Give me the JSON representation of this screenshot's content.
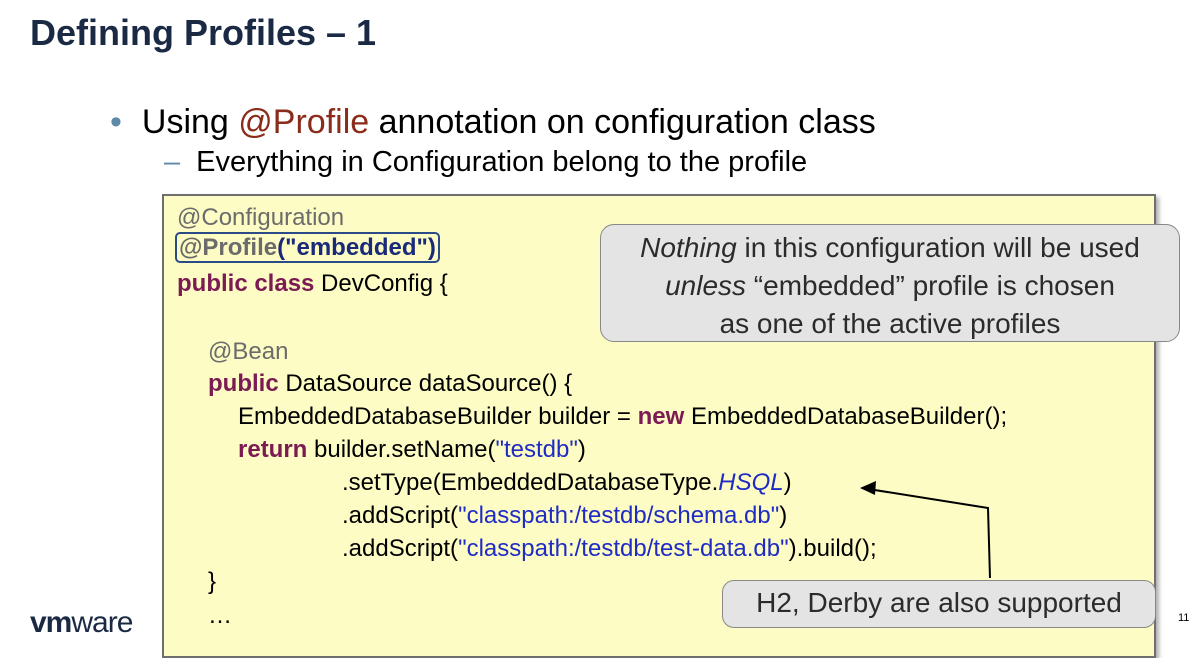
{
  "slide": {
    "title": "Defining Profiles – 1",
    "bullet": {
      "prefix": "Using ",
      "annotation": "@Profile",
      "suffix": " annotation on configuration class"
    },
    "subbullet": "Everything in Configuration belong to the profile",
    "page_number": "11",
    "logo": {
      "vm": "vm",
      "ware": "ware"
    }
  },
  "code": {
    "l1": "@Configuration",
    "l2_ann": "@Profile",
    "l2_str": "(\"embedded\")",
    "l3_kw": "public class",
    "l3_rest": " DevConfig {",
    "l4": "@Bean",
    "l5_kw": "public",
    "l5_rest": " DataSource dataSource() {",
    "l6_a": "EmbeddedDatabaseBuilder builder = ",
    "l6_kw": "new",
    "l6_b": " EmbeddedDatabaseBuilder();",
    "l7_kw": "return",
    "l7_a": " builder.setName(",
    "l7_str": "\"testdb\"",
    "l7_b": ")",
    "l8_a": ".setType(EmbeddedDatabaseType.",
    "l8_it": "HSQL",
    "l8_b": ")",
    "l9_a": ".addScript(",
    "l9_str": "\"classpath:/testdb/schema.db\"",
    "l9_b": ")",
    "l10_a": ".addScript(",
    "l10_str": "\"classpath:/testdb/test-data.db\"",
    "l10_b": ").build();",
    "l11": "}",
    "l12": "…"
  },
  "callouts": {
    "main": {
      "line1_it": "Nothing",
      "line1_rest": " in this configuration will be used",
      "line2_it": "unless",
      "line2_rest": " “embedded” profile is chosen",
      "line3": "as one of the active profiles"
    },
    "db": "H2, Derby are also supported"
  }
}
